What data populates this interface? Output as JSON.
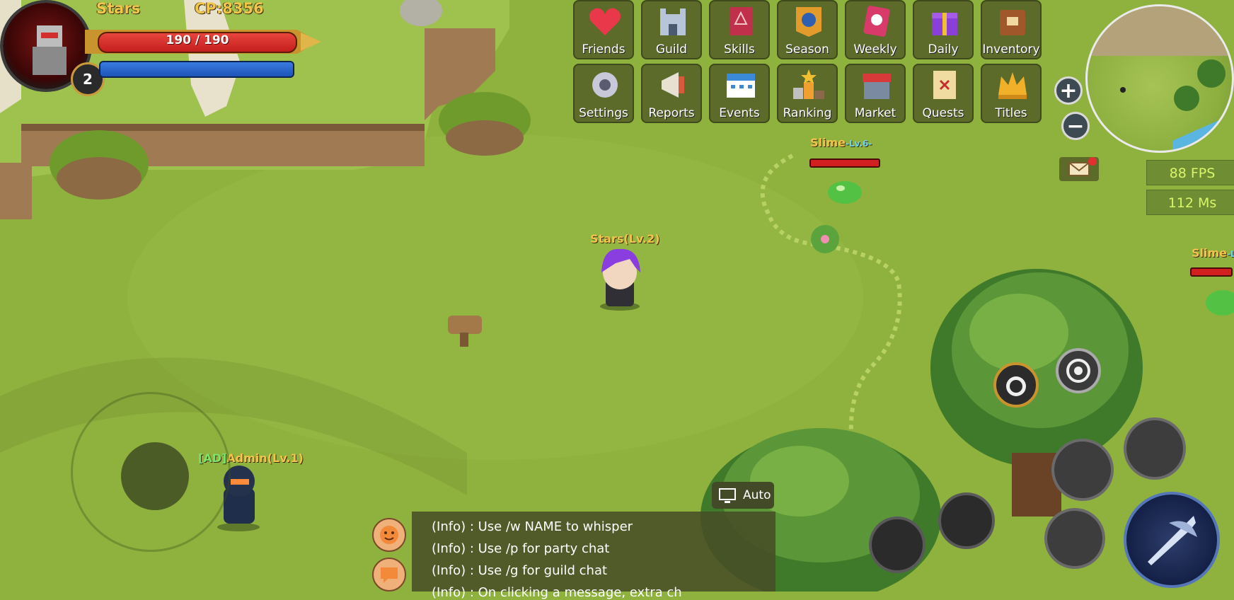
{
  "player": {
    "name": "Stars",
    "cp": "CP:8356",
    "hp_text": "190 / 190",
    "hp_fraction": 1.0,
    "mp_fraction": 1.0,
    "level": "2",
    "world_tag": "Stars(Lv.2)"
  },
  "menu": {
    "row1": [
      {
        "label": "Friends",
        "icon": "heart-icon"
      },
      {
        "label": "Guild",
        "icon": "castle-icon"
      },
      {
        "label": "Skills",
        "icon": "skillbook-icon"
      },
      {
        "label": "Season",
        "icon": "season-banner-icon"
      },
      {
        "label": "Weekly",
        "icon": "weekly-card-icon"
      },
      {
        "label": "Daily",
        "icon": "gift-box-icon"
      },
      {
        "label": "Inventory",
        "icon": "backpack-icon"
      }
    ],
    "row2": [
      {
        "label": "Settings",
        "icon": "gear-icon"
      },
      {
        "label": "Reports",
        "icon": "megaphone-icon"
      },
      {
        "label": "Events",
        "icon": "calendar-icon"
      },
      {
        "label": "Ranking",
        "icon": "podium-icon"
      },
      {
        "label": "Market",
        "icon": "shop-icon"
      },
      {
        "label": "Quests",
        "icon": "map-scroll-icon"
      },
      {
        "label": "Titles",
        "icon": "crown-icon"
      }
    ]
  },
  "hud": {
    "fps": "88 FPS",
    "ping": "112 Ms",
    "zoom_in": "+",
    "zoom_out": "−",
    "auto_label": "Auto"
  },
  "entities": {
    "slime1_name": "Slime",
    "slime1_level": "-Lv.6-",
    "slime2_name": "Slime",
    "slime2_level": "-Lv",
    "admin_prefix": "[AD]",
    "admin_name": "Admin(Lv.1)"
  },
  "chat": {
    "lines": [
      "(Info) : Use /w NAME to whisper",
      "(Info) : Use /p for party chat",
      "(Info) : Use /g for guild chat",
      "(Info) : On clicking a message, extra ch"
    ]
  },
  "colors": {
    "grass": "#8fb13e",
    "hp": "#d22020",
    "mp": "#2a66cc",
    "gold_text": "#f1c64a",
    "menu_bg": "#5c6a2a"
  }
}
